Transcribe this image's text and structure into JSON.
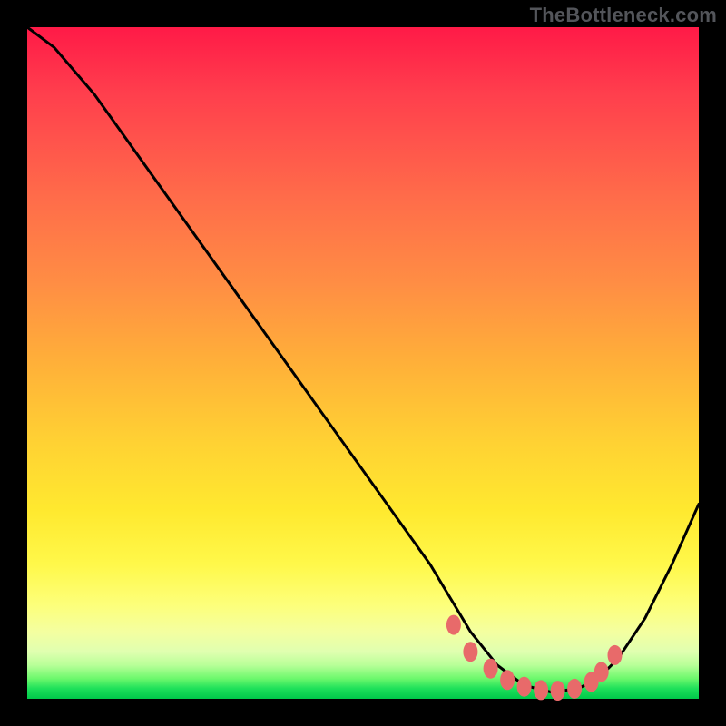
{
  "watermark": {
    "text": "TheBottleneck.com"
  },
  "colors": {
    "curve_stroke": "#000000",
    "marker_fill": "#e86a6a",
    "marker_stroke": "#c24a4a",
    "gradient_top": "#ff1a47",
    "gradient_bottom": "#00c84a",
    "background": "#000000"
  },
  "chart_data": {
    "type": "line",
    "title": "",
    "xlabel": "",
    "ylabel": "",
    "xlim": [
      0,
      100
    ],
    "ylim": [
      0,
      100
    ],
    "grid": false,
    "legend": null,
    "note": "Axes are not labeled in the image; x/y are normalized 0–100. y=0 is green band (bottom), y=100 is red (top). The curve starts very high at the left, descends nearly linearly to a broad minimum around x≈72–84 (near y≈0), then rises toward the right edge.",
    "series": [
      {
        "name": "curve",
        "x": [
          0,
          4,
          10,
          20,
          30,
          40,
          50,
          55,
          60,
          63,
          66,
          70,
          74,
          78,
          82,
          85,
          88,
          92,
          96,
          100
        ],
        "y": [
          100,
          97,
          90,
          76,
          62,
          48,
          34,
          27,
          20,
          15,
          10,
          5,
          2,
          1,
          1.5,
          3,
          6,
          12,
          20,
          29
        ]
      }
    ],
    "markers": {
      "name": "highlight-points",
      "note": "Salmon dots along/near the valley of the curve.",
      "x": [
        63.5,
        66,
        69,
        71.5,
        74,
        76.5,
        79,
        81.5,
        84,
        85.5,
        87.5
      ],
      "y": [
        11,
        7,
        4.5,
        2.8,
        1.8,
        1.3,
        1.2,
        1.5,
        2.5,
        4,
        6.5
      ]
    }
  }
}
